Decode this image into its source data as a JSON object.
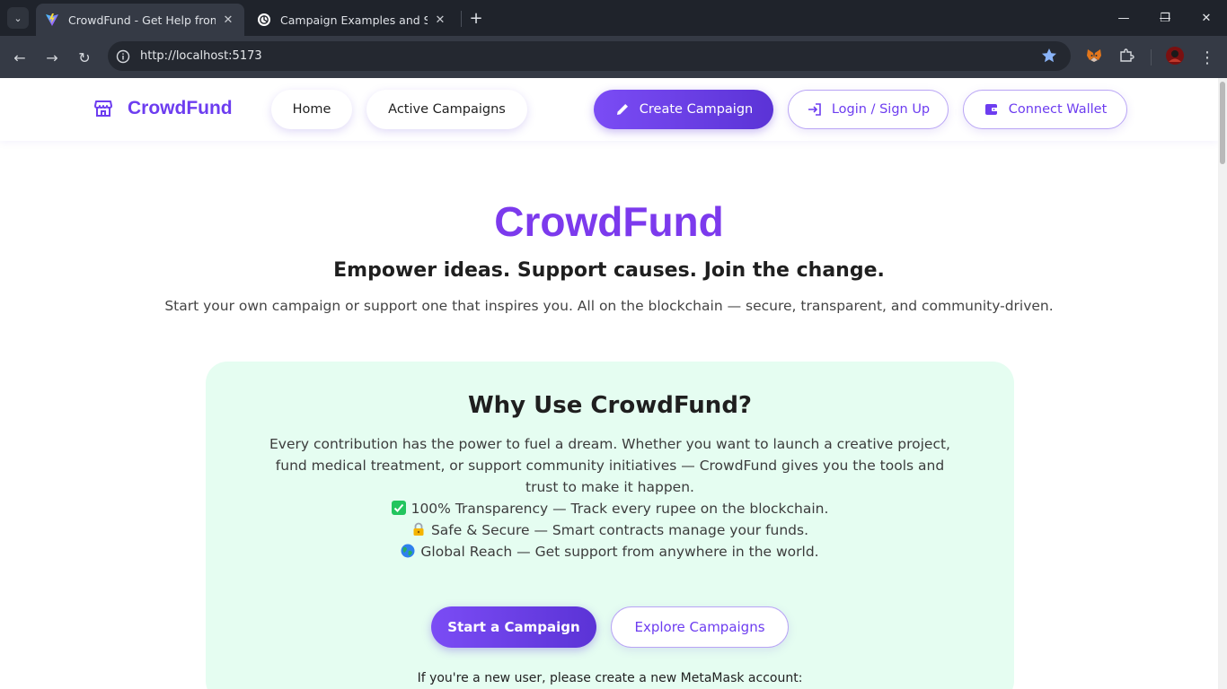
{
  "browser": {
    "tabs": [
      {
        "title": "CrowdFund - Get Help from Crowd",
        "active": true
      },
      {
        "title": "Campaign Examples and Setup",
        "active": false
      }
    ],
    "url": "http://localhost:5173"
  },
  "nav": {
    "brand": "CrowdFund",
    "home": "Home",
    "active_campaigns": "Active Campaigns",
    "create_campaign": "Create Campaign",
    "login": "Login / Sign Up",
    "connect_wallet": "Connect Wallet"
  },
  "hero": {
    "title": "CrowdFund",
    "tagline": "Empower ideas. Support causes. Join the change.",
    "subtitle": "Start your own campaign or support one that inspires you. All on the blockchain — secure, transparent, and community-driven."
  },
  "why": {
    "title": "Why Use CrowdFund?",
    "body": "Every contribution has the power to fuel a dream. Whether you want to launch a creative project, fund medical treatment, or support community initiatives — CrowdFund gives you the tools and trust to make it happen.",
    "features": [
      {
        "icon": "check-mark-icon",
        "text": "100% Transparency — Track every rupee on the blockchain."
      },
      {
        "icon": "lock-icon",
        "text": "Safe & Secure — Smart contracts manage your funds."
      },
      {
        "icon": "globe-icon",
        "text": "Global Reach — Get support from anywhere in the world."
      }
    ],
    "start_button": "Start a Campaign",
    "explore_button": "Explore Campaigns",
    "note": "If you're a new user, please create a new MetaMask account:"
  },
  "colors": {
    "brand": "#6d3df0",
    "hero_title": "#7c3aed",
    "card_bg": "#e5fdf1"
  }
}
